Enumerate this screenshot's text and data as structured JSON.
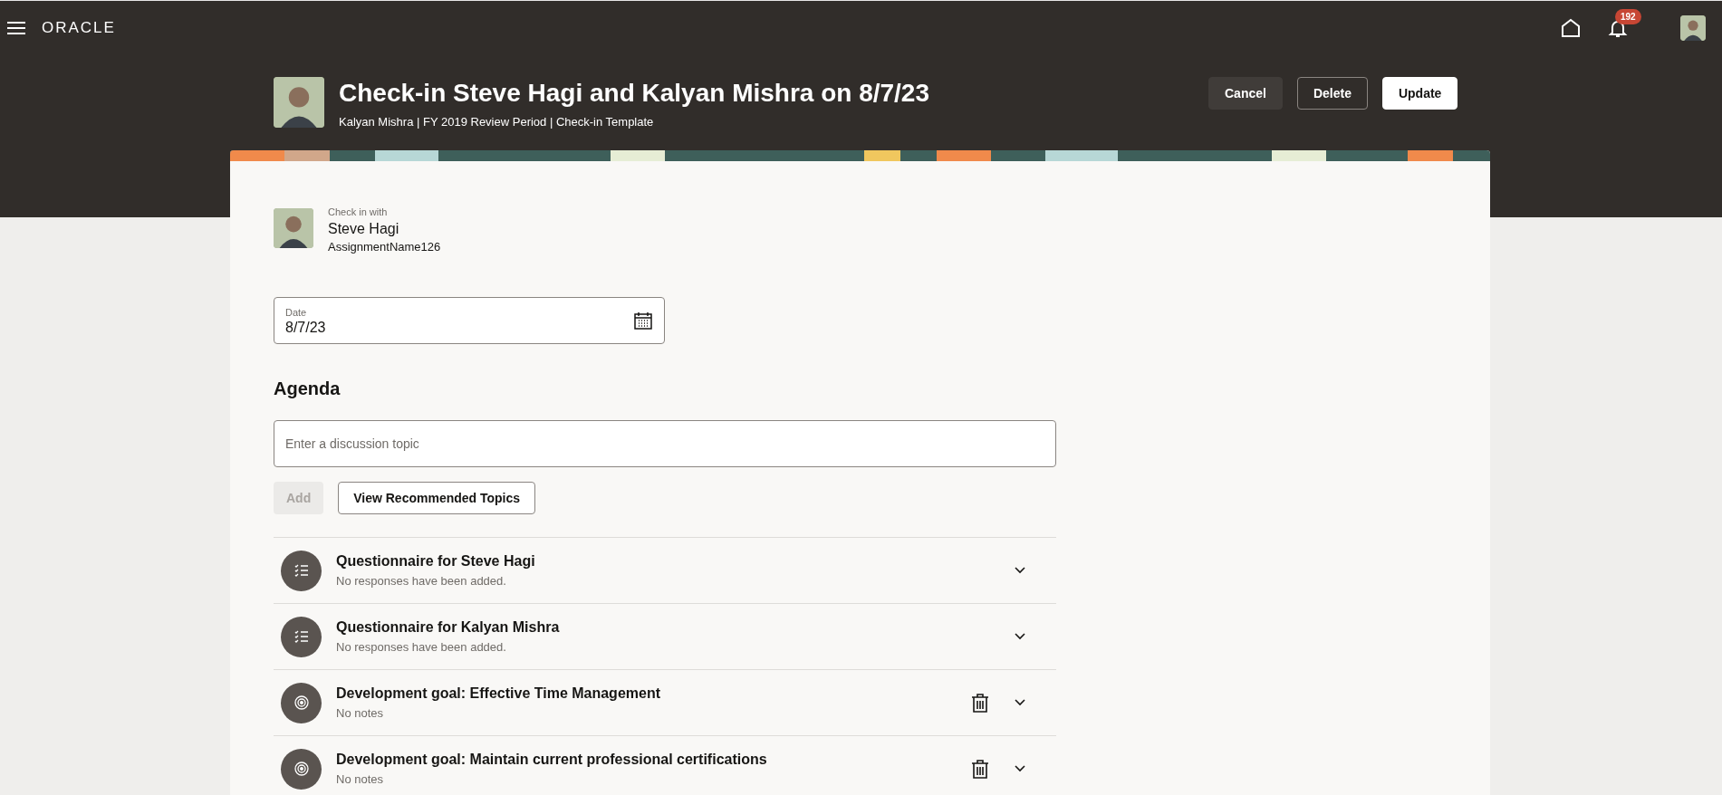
{
  "top_bar": {
    "logo": "ORACLE",
    "notification_count": "192"
  },
  "header": {
    "title": "Check-in Steve Hagi and Kalyan Mishra on 8/7/23",
    "subtitle": "Kalyan Mishra | FY 2019 Review Period | Check-in Template",
    "buttons": [
      {
        "label": "Cancel",
        "kind": "secondary"
      },
      {
        "label": "Delete",
        "kind": "outline"
      },
      {
        "label": "Update",
        "kind": "primary"
      }
    ]
  },
  "check_in_with": {
    "label": "Check in with",
    "name": "Steve Hagi",
    "assignment": "AssignmentName126"
  },
  "date_field": {
    "label": "Date",
    "value": "8/7/23"
  },
  "agenda": {
    "heading": "Agenda",
    "topic_field": {
      "placeholder": "Enter a discussion topic"
    },
    "add_button": {
      "label": "Add",
      "disabled": true
    },
    "recommended_button": "View Recommended Topics",
    "items": [
      {
        "kind": "questionnaire",
        "title": "Questionnaire for Steve Hagi",
        "detail": "No responses have been added.",
        "deletable": false
      },
      {
        "kind": "questionnaire",
        "title": "Questionnaire for Kalyan Mishra",
        "detail": "No responses have been added.",
        "deletable": false
      },
      {
        "kind": "goal",
        "title": "Development goal: Effective Time Management",
        "detail": "No notes",
        "deletable": true
      },
      {
        "kind": "goal",
        "title": "Development goal: Maintain current professional certifications",
        "detail": "No notes",
        "deletable": true
      }
    ]
  }
}
